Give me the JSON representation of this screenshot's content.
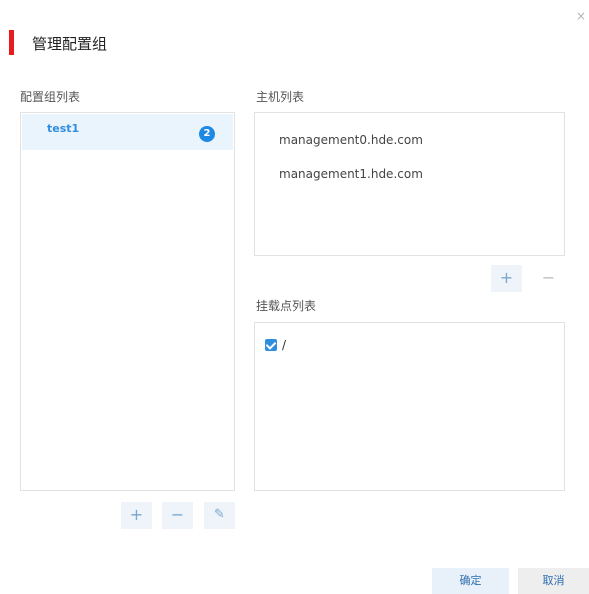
{
  "dialog": {
    "title": "管理配置组",
    "close_glyph": "×",
    "accent_color": "#e81c1c"
  },
  "group_panel": {
    "label": "配置组列表",
    "items": [
      {
        "name": "test1",
        "count": "2",
        "selected": true
      }
    ],
    "add_glyph": "+",
    "remove_glyph": "−",
    "edit_glyph": "✎"
  },
  "host_panel": {
    "label": "主机列表",
    "hosts": [
      "management0.hde.com",
      "management1.hde.com"
    ],
    "add_glyph": "+",
    "remove_glyph": "−"
  },
  "mount_panel": {
    "label": "挂载点列表",
    "items": [
      {
        "path": "/",
        "checked": true
      }
    ]
  },
  "footer": {
    "ok_label": "确定",
    "cancel_label": "取消"
  },
  "icons": {
    "close": "close-icon",
    "add": "plus-icon",
    "remove": "minus-icon",
    "edit": "pencil-icon",
    "check": "checkbox-checked-icon"
  },
  "colors": {
    "accent_red": "#e81c1c",
    "primary_blue": "#2f8ee0",
    "badge_blue": "#1e88e5",
    "selection_bg": "#eaf4fd"
  }
}
